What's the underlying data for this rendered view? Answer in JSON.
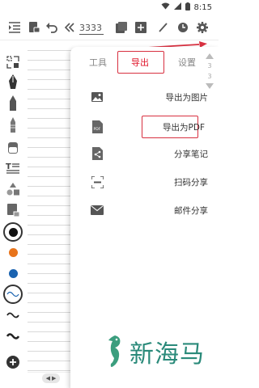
{
  "status_bar": {
    "time": "8:15"
  },
  "toolbar": {
    "page_number": "3333"
  },
  "popup": {
    "tabs": [
      {
        "label": "工具"
      },
      {
        "label": "导出"
      },
      {
        "label": "设置"
      }
    ],
    "active_tab": "导出",
    "scroll_indicators": [
      "3",
      "3"
    ],
    "items": [
      {
        "label": "导出为图片",
        "icon": "image-icon"
      },
      {
        "label": "导出为PDF",
        "icon": "pdf-file-icon"
      },
      {
        "label": "分享笔记",
        "icon": "share-file-icon"
      },
      {
        "label": "扫码分享",
        "icon": "qr-scan-icon"
      },
      {
        "label": "邮件分享",
        "icon": "mail-icon"
      }
    ]
  },
  "toolbox": {
    "colors": [
      "#111111",
      "#e8741b",
      "#1a63b0"
    ]
  },
  "watermark": {
    "text": "新海马"
  },
  "accent_color": "#d83040"
}
